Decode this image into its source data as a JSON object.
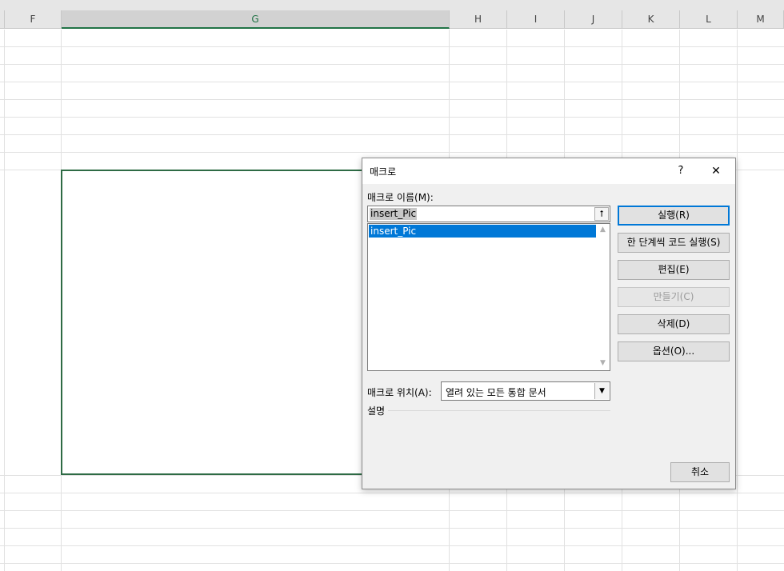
{
  "sheet": {
    "columns": [
      "F",
      "G",
      "H",
      "I",
      "J",
      "K",
      "L",
      "M"
    ],
    "selected_column": "G"
  },
  "dialog": {
    "title": "매크로",
    "help_label": "?",
    "close_label": "✕",
    "name_label": "매크로 이름(M):",
    "name_value": "insert_Pic",
    "name_up_icon": "⭡",
    "macro_list": [
      "insert_Pic"
    ],
    "location_label": "매크로 위치(A):",
    "location_value": "열려 있는 모든 통합 문서",
    "description_label": "설명",
    "buttons": {
      "run": "실행(R)",
      "step_into": "한 단계씩 코드 실행(S)",
      "edit": "편집(E)",
      "create": "만들기(C)",
      "delete": "삭제(D)",
      "options": "옵션(O)...",
      "cancel": "취소"
    }
  },
  "colors": {
    "accent": "#0078d7",
    "selection_green": "#217346"
  }
}
